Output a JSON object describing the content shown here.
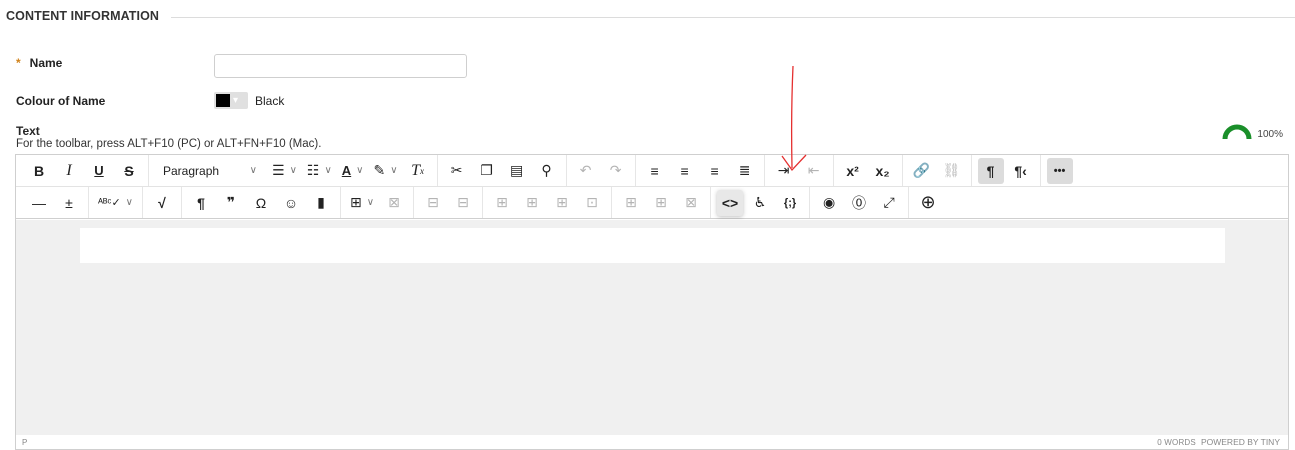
{
  "section": {
    "title": "CONTENT INFORMATION"
  },
  "name_field": {
    "required_mark": "*",
    "label": "Name",
    "value": "",
    "placeholder": ""
  },
  "colour_field": {
    "label": "Colour of Name",
    "swatch_color": "#000000",
    "value": "Black"
  },
  "text_field": {
    "label": "Text",
    "hint": "For the toolbar, press ALT+F10 (PC) or ALT+FN+F10 (Mac).",
    "progress_percent": "100%",
    "progress_color": "#1a8f2a"
  },
  "toolbar": {
    "row1": {
      "bold": "B",
      "italic": "I",
      "underline": "U",
      "strike": "S",
      "block_format": "Paragraph",
      "block_format_chevron": "⌄",
      "bullet_list": "☰",
      "numbered_list": "☷",
      "text_color": "A",
      "highlight": "✎",
      "clear_format": "Tx",
      "cut": "✂",
      "copy": "❐",
      "paste": "📋",
      "find": "⌕",
      "undo": "↶",
      "redo": "↷",
      "align_left": "≡",
      "align_center": "≡",
      "align_right": "≡",
      "justify": "≡",
      "indent": "⇥",
      "outdent": "⇤",
      "superscript": "x²",
      "subscript": "x₂",
      "link": "🔗",
      "unlink": "⛓",
      "ltr": "¶",
      "rtl": "¶‹",
      "more": "•••"
    },
    "row2": {
      "hr": "—",
      "nonbreaking": "±",
      "spellcheck": "ABC✓",
      "math": "√",
      "pilcrow": "¶",
      "quote": "❞",
      "omega": "Ω",
      "emoji": "☺",
      "bookmark": "▮",
      "table": "⊞",
      "code": "<>",
      "accessibility": "♿",
      "template": "{;}",
      "preview": "◉",
      "help": "?",
      "fullscreen": "⤢",
      "insert": "⊕"
    }
  },
  "editor": {
    "status_path": "P",
    "word_count": "0 WORDS",
    "powered_by": "POWERED BY TINY"
  },
  "annotation": {
    "arrow_color": "#e53030"
  }
}
